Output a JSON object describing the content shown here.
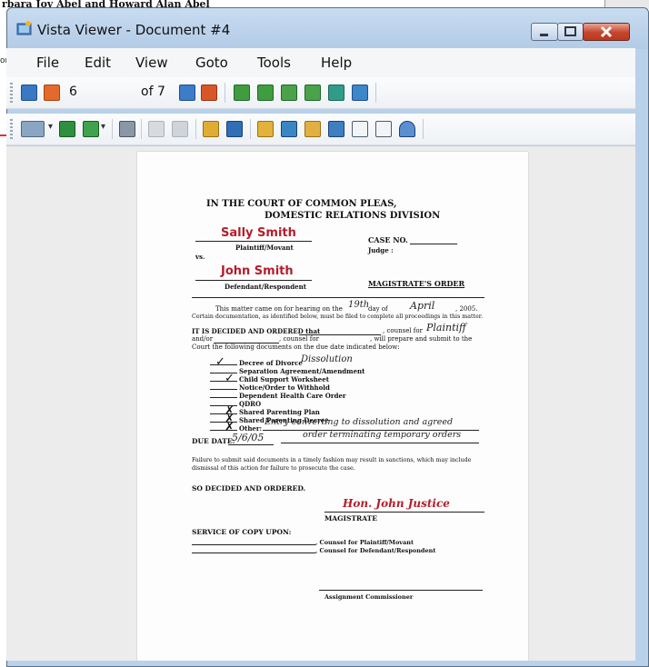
{
  "background": {
    "caption": "rbara Joy Abel and Howard Alan Abel",
    "left_fragment": "or"
  },
  "window": {
    "title": "Vista Viewer - Document #4",
    "buttons": {
      "minimize": "minimize-icon",
      "maximize": "maximize-icon",
      "close": "close-icon"
    }
  },
  "menu": [
    "File",
    "Edit",
    "View",
    "Goto",
    "Tools",
    "Help"
  ],
  "toolbar": {
    "page_current": "6",
    "page_of": "of 7"
  },
  "document": {
    "court_line1": "IN THE COURT OF COMMON PLEAS,",
    "court_line2": "DOMESTIC RELATIONS DIVISION",
    "plaintiff_name": "Sally Smith",
    "plaintiff_label": "Plaintiff/Movant",
    "vs": "vs.",
    "case_no": "CASE NO.",
    "judge": "Judge :",
    "defendant_name": "John Smith",
    "defendant_label": "Defendant/Respondent",
    "order_title": "MAGISTRATE'S ORDER",
    "para1_a": "This matter came on for hearing on the",
    "para1_day": "19th",
    "para1_b": "day of",
    "para1_month": "April",
    "para1_year": ", 2005.",
    "para1_line2": "Certain documentation, as identified below, must be filed to complete all proceedings in this matter.",
    "para2_a": "IT IS DECIDED AND ORDERED that",
    "para2_b": ", counsel for",
    "para2_party": "Plaintiff",
    "para2_line2_a": "and/or",
    "para2_line2_b": ", counsel for",
    "para2_line2_c": ", will prepare and submit to the",
    "para2_line3": "Court the following documents on the due date indicated below:",
    "items": [
      {
        "mark": "✓",
        "label": "Decree of Divorce",
        "note": "Dissolution"
      },
      {
        "mark": "",
        "label": "Separation Agreement/Amendment",
        "note": ""
      },
      {
        "mark": "✓",
        "label": "Child Support Worksheet",
        "note": ""
      },
      {
        "mark": "",
        "label": "Notice/Order to Withhold",
        "note": ""
      },
      {
        "mark": "",
        "label": "Dependent Health Care Order",
        "note": ""
      },
      {
        "mark": "",
        "label": "QDRO",
        "note": ""
      },
      {
        "mark": "✗",
        "label": "Shared Parenting Plan",
        "note": ""
      },
      {
        "mark": "✗",
        "label": "Shared Parenting Decree",
        "note": ""
      },
      {
        "mark": "✗",
        "label": "Other:",
        "note": "Entry converting to dissolution and agreed"
      }
    ],
    "other_line2": "order terminating temporary orders",
    "due_label": "DUE DATE:",
    "due_value": "5/6/05",
    "failure_1": "Failure to submit said documents in a timely fashion may result in sanctions, which may include",
    "failure_2": "dismissal of this action for failure to prosecute the case.",
    "so_decided": "SO DECIDED AND ORDERED.",
    "signature": "Hon. John Justice",
    "magistrate": "MAGISTRATE",
    "service": "SERVICE OF COPY UPON:",
    "counsel_pl": ", Counsel for Plaintiff/Movant",
    "counsel_def": ", Counsel for Defendant/Respondent",
    "assignment": "Assignment Commissioner"
  }
}
